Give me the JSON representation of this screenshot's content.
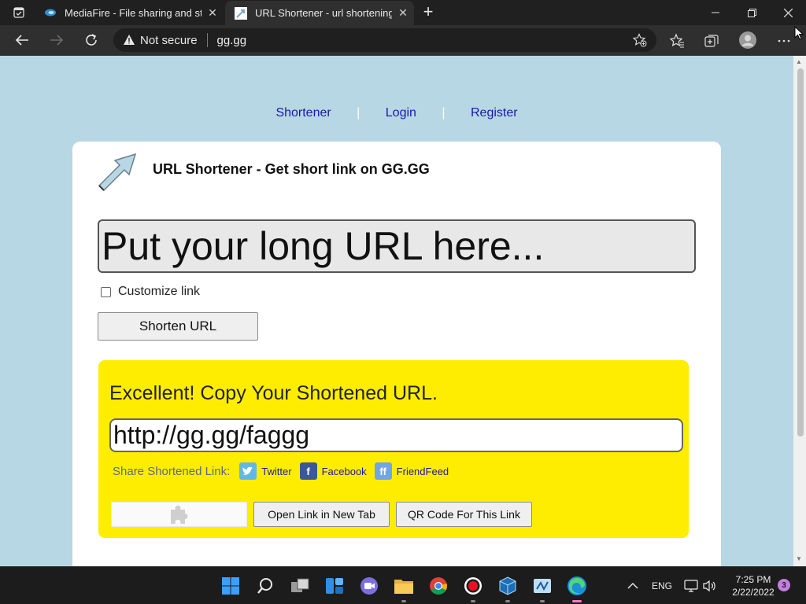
{
  "browser": {
    "tabs": [
      {
        "title": "MediaFire - File sharing and storage made simple",
        "active": false
      },
      {
        "title": "URL Shortener - url shortening service",
        "active": true
      }
    ],
    "security_label": "Not secure",
    "address": "gg.gg"
  },
  "page": {
    "nav": {
      "shortener": "Shortener",
      "login": "Login",
      "register": "Register",
      "separator": "|"
    },
    "title": "URL Shortener - Get short link on GG.GG",
    "long_url_placeholder": "Put your long URL here...",
    "customize_label": "Customize link",
    "shorten_button": "Shorten URL",
    "result": {
      "heading": "Excellent! Copy Your Shortened URL.",
      "short_url": "http://gg.gg/faggg",
      "share_label": "Share Shortened Link:",
      "share_links": {
        "twitter": "Twitter",
        "facebook": "Facebook",
        "friendfeed": "FriendFeed"
      },
      "open_button": "Open Link in New Tab",
      "qr_button": "QR Code For This Link"
    },
    "colors": {
      "page_bg": "#b7d7e4",
      "result_bg": "#ffed00",
      "link": "#1a1aa8"
    }
  },
  "taskbar": {
    "language": "ENG",
    "time": "7:25 PM",
    "date": "2/22/2022",
    "notification_count": "3"
  }
}
